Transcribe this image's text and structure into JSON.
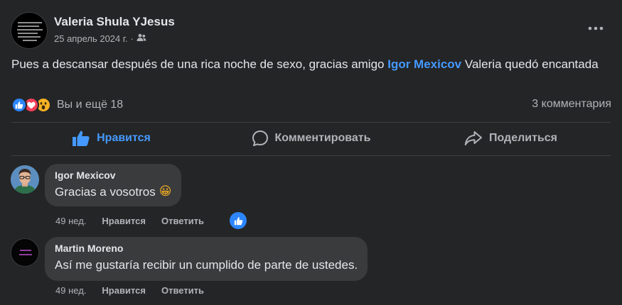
{
  "post": {
    "author": "Valeria Shula YJesus",
    "date": "25 апрель 2024 г.",
    "separator": "·",
    "audience_icon": "friends-icon",
    "text_before": "Pues a descansar después de una rica noche de sexo, gracias amigo ",
    "mention": "Igor Mexicov",
    "text_after": " Valeria quedó encantada",
    "reactions_label": "Вы и ещё 18",
    "comments_count": "3 комментария"
  },
  "actions": {
    "like": "Нравится",
    "comment": "Комментировать",
    "share": "Поделиться"
  },
  "comments": [
    {
      "name": "Igor Mexicov",
      "text": "Gracias a vosotros",
      "emoji": "😀",
      "time": "49 нед.",
      "like": "Нравится",
      "reply": "Ответить"
    },
    {
      "name": "Martin Moreno",
      "text": "Así me gustaría recibir un cumplido de parte de ustedes.",
      "time": "49 нед.",
      "like": "Нравится",
      "reply": "Ответить"
    }
  ],
  "colors": {
    "background": "#242526",
    "bubble": "#3a3b3c",
    "accent": "#4599ff",
    "secondary_text": "#b0b3b8"
  }
}
